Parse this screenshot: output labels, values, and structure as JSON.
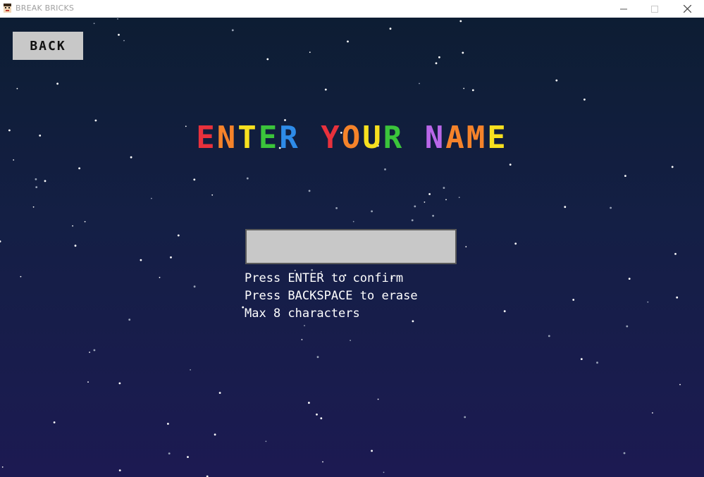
{
  "window": {
    "title": "BREAK BRICKS",
    "controls": {
      "minimize": "minimize-icon",
      "maximize": "maximize-icon",
      "close": "close-icon"
    }
  },
  "screen": {
    "back_label": "BACK",
    "title_words": [
      {
        "text": "ENTER",
        "letter_colors": [
          "#e8313c",
          "#f5832a",
          "#f7e01f",
          "#3bc43b",
          "#2e8be8"
        ]
      },
      {
        "text": "YOUR",
        "letter_colors": [
          "#e8313c",
          "#f5832a",
          "#f7e01f",
          "#3bc43b"
        ]
      },
      {
        "text": "NAME",
        "letter_colors": [
          "#b967e8",
          "#f5832a",
          "#f5832a",
          "#f7e01f"
        ]
      }
    ],
    "name_input": {
      "value": "",
      "placeholder": ""
    },
    "instructions": [
      "Press ENTER to confirm",
      "Press BACKSPACE to erase",
      "Max 8 characters"
    ]
  },
  "colors": {
    "background_top": "#0d1d33",
    "background_bottom": "#1c1a52",
    "button_fill": "#c8c8c8",
    "text": "#ffffff"
  }
}
